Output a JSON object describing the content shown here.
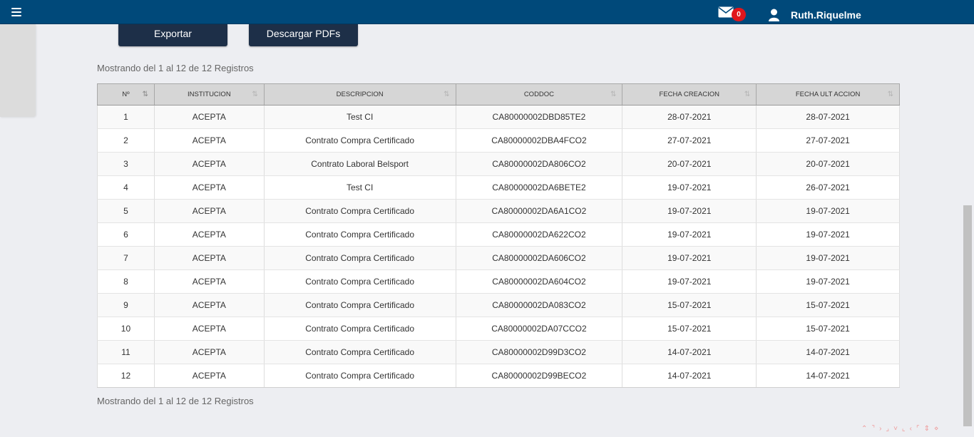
{
  "header": {
    "mail_count": "0",
    "user_name": "Ruth.Riquelme"
  },
  "toolbar": {
    "export_label": "Exportar",
    "pdfs_label": "Descargar PDFs"
  },
  "records_info_top": "Mostrando del 1 al 12 de 12 Registros",
  "records_info_bottom": "Mostrando del 1 al 12 de 12 Registros",
  "table": {
    "columns": [
      "Nº",
      "INSTITUCION",
      "DESCRIPCION",
      "CODDOC",
      "FECHA CREACION",
      "FECHA ULT ACCION"
    ],
    "rows": [
      [
        "1",
        "ACEPTA",
        "Test CI",
        "CA80000002DBD85TE2",
        "28-07-2021",
        "28-07-2021"
      ],
      [
        "2",
        "ACEPTA",
        "Contrato Compra Certificado",
        "CA80000002DBA4FCO2",
        "27-07-2021",
        "27-07-2021"
      ],
      [
        "3",
        "ACEPTA",
        "Contrato Laboral Belsport",
        "CA80000002DA806CO2",
        "20-07-2021",
        "20-07-2021"
      ],
      [
        "4",
        "ACEPTA",
        "Test CI",
        "CA80000002DA6BETE2",
        "19-07-2021",
        "26-07-2021"
      ],
      [
        "5",
        "ACEPTA",
        "Contrato Compra Certificado",
        "CA80000002DA6A1CO2",
        "19-07-2021",
        "19-07-2021"
      ],
      [
        "6",
        "ACEPTA",
        "Contrato Compra Certificado",
        "CA80000002DA622CO2",
        "19-07-2021",
        "19-07-2021"
      ],
      [
        "7",
        "ACEPTA",
        "Contrato Compra Certificado",
        "CA80000002DA606CO2",
        "19-07-2021",
        "19-07-2021"
      ],
      [
        "8",
        "ACEPTA",
        "Contrato Compra Certificado",
        "CA80000002DA604CO2",
        "19-07-2021",
        "19-07-2021"
      ],
      [
        "9",
        "ACEPTA",
        "Contrato Compra Certificado",
        "CA80000002DA083CO2",
        "15-07-2021",
        "15-07-2021"
      ],
      [
        "10",
        "ACEPTA",
        "Contrato Compra Certificado",
        "CA80000002DA07CCO2",
        "15-07-2021",
        "15-07-2021"
      ],
      [
        "11",
        "ACEPTA",
        "Contrato Compra Certificado",
        "CA80000002D99D3CO2",
        "14-07-2021",
        "14-07-2021"
      ],
      [
        "12",
        "ACEPTA",
        "Contrato Compra Certificado",
        "CA80000002D99BECO2",
        "14-07-2021",
        "14-07-2021"
      ]
    ]
  },
  "colors": {
    "topbar": "#00497a",
    "button": "#1d2f48",
    "badge": "#e0161c"
  }
}
